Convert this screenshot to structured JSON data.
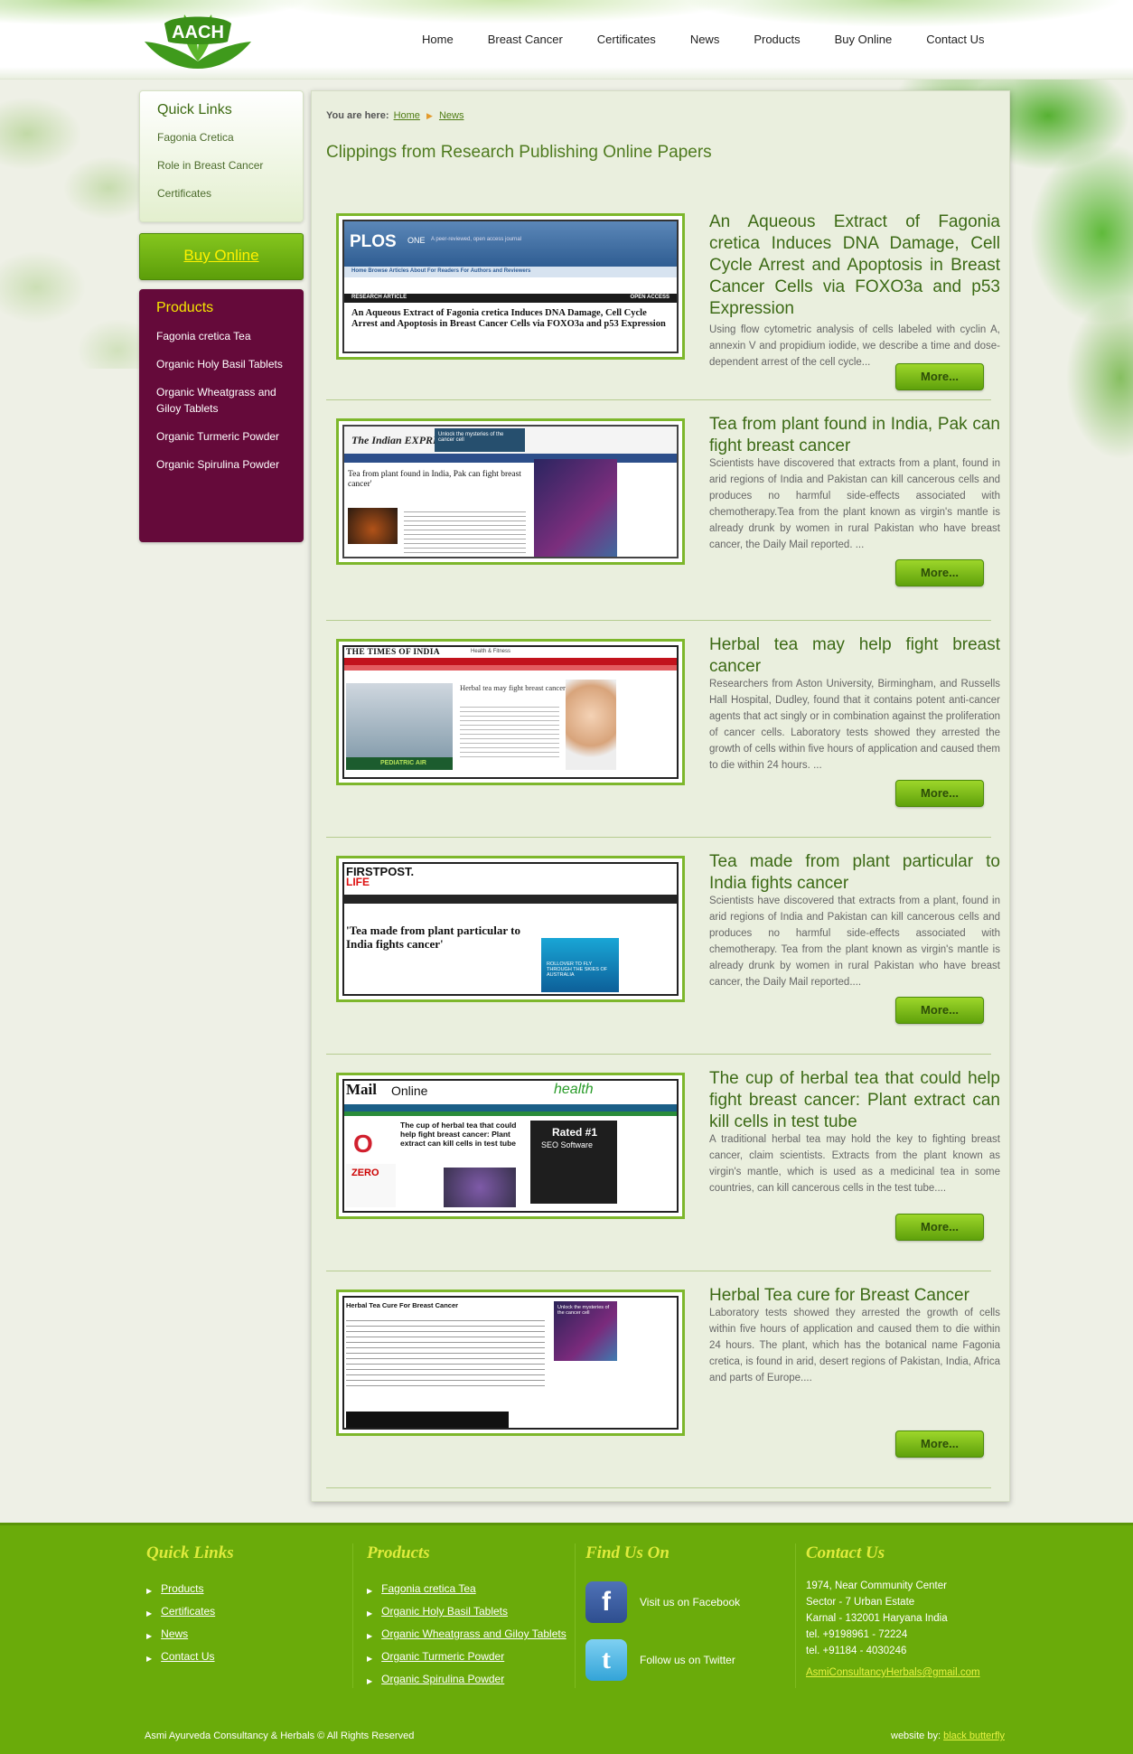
{
  "nav": [
    "Home",
    "Breast Cancer",
    "Certificates",
    "News",
    "Products",
    "Buy Online",
    "Contact Us"
  ],
  "logo_text": "AACH",
  "sidebar": {
    "quick_links_title": "Quick Links",
    "quick_links": [
      "Fagonia Cretica",
      "Role in Breast Cancer",
      "Certificates"
    ],
    "buy_online": "Buy Online",
    "products_title": "Products",
    "products": [
      "Fagonia cretica Tea",
      "Organic Holy Basil Tablets",
      "Organic Wheatgrass and Giloy Tablets",
      "Organic Turmeric Powder",
      "Organic Spirulina Powder"
    ]
  },
  "breadcrumb": {
    "label": "You are here:",
    "home": "Home",
    "current": "News"
  },
  "page_title": "Clippings from Research Publishing Online Papers",
  "more_label": "More...",
  "articles": [
    {
      "title": "An Aqueous Extract of Fagonia cretica Induces DNA Damage, Cell Cycle Arrest and Apoptosis in Breast Cancer Cells via FOXO3a and p53 Expression",
      "text": "Using flow cytometric analysis of cells labeled with cyclin A, annexin V and propidium iodide, we describe a time and dose-dependent arrest of the cell cycle..."
    },
    {
      "title": "Tea from plant found in India, Pak can fight breast cancer",
      "text": "Scientists have discovered that extracts from a plant, found in arid regions of India and Pakistan can kill cancerous cells and produces no harmful side-effects associated with chemotherapy.Tea from the plant known as virgin's mantle is already drunk by women in rural Pakistan who have breast cancer, the Daily Mail reported. ..."
    },
    {
      "title": "Herbal tea may help fight breast cancer",
      "text": "Researchers from Aston University, Birmingham, and Russells Hall Hospital, Dudley, found that it contains potent anti-cancer agents that act singly or in combination against the proliferation of cancer cells. Laboratory tests showed they arrested the growth of cells within five hours of application and caused them to die within 24 hours. ..."
    },
    {
      "title": "Tea made from plant particular to India fights cancer",
      "text": "Scientists have discovered that extracts from a plant, found in arid regions of India and Pakistan can kill cancerous cells and produces no harmful side-effects associated with chemotherapy. Tea from the plant known as virgin's mantle is already drunk by women in rural Pakistan who have breast cancer, the Daily Mail reported...."
    },
    {
      "title": "The cup of herbal tea that could help fight breast cancer: Plant extract can kill cells in test tube",
      "text": "A traditional herbal tea may hold the key to fighting breast cancer, claim scientists. Extracts from the plant known as virgin's mantle, which is used as a medicinal tea in some countries, can kill cancerous cells in the test tube...."
    },
    {
      "title": "Herbal Tea cure for Breast Cancer",
      "text": "Laboratory tests showed they arrested the growth of cells within five hours of application and caused them to die within 24 hours. The plant, which has the botanical name Fagonia cretica, is found in arid, desert regions of Pakistan, India, Africa and parts of Europe...."
    }
  ],
  "clippings": {
    "c1": {
      "brand": "PLOS",
      "one": "ONE",
      "tagline": "A peer-reviewed, open access journal",
      "nav": "Home   Browse Articles   About   For Readers   For Authors and Reviewers",
      "tag": "RESEARCH ARTICLE",
      "open": "OPEN ACCESS",
      "headline": "An Aqueous Extract of Fagonia cretica Induces DNA Damage, Cell Cycle Arrest and Apoptosis in Breast Cancer Cells via FOXO3a and p53 Expression"
    },
    "c2": {
      "paper": "The Indian EXPRESS",
      "ad": "Unlock the mysteries of the cancer cell",
      "headline": "Tea from plant found in India, Pak can fight breast cancer'"
    },
    "c3": {
      "paper": "THE TIMES OF INDIA",
      "section": "Health & Fitness",
      "headline": "Herbal tea may fight breast cancer",
      "ad": "PEDIATRIC AIR"
    },
    "c4": {
      "paper": "FIRSTPOST.",
      "sub": "LIFE",
      "headline": "'Tea made from plant particular to India fights cancer'",
      "ad": "ROLLOVER TO FLY THROUGH THE SKIES OF AUSTRALIA"
    },
    "c5": {
      "paper": "Mail",
      "online": "Online",
      "health": "health",
      "headline": "The cup of herbal tea that could help fight breast cancer: Plant extract can kill cells in test tube",
      "ad1": "ZERO",
      "ad2": "Rated #1",
      "ad3": "SEO Software"
    },
    "c6": {
      "headline": "Herbal Tea Cure For Breast Cancer",
      "ad": "Unlock the mysteries of the cancer cell"
    }
  },
  "footer": {
    "quick_title": "Quick Links",
    "quick": [
      "Products",
      "Certificates",
      "News",
      "Contact Us"
    ],
    "products_title": "Products",
    "products": [
      "Fagonia cretica Tea",
      "Organic Holy Basil Tablets",
      "Organic Wheatgrass and Giloy Tablets",
      "Organic Turmeric Powder",
      "Organic Spirulina Powder"
    ],
    "find_title": "Find Us On",
    "facebook": "Visit us on Facebook",
    "twitter": "Follow us on Twitter",
    "contact_title": "Contact Us",
    "address": [
      "1974, Near Community Center",
      "Sector - 7 Urban Estate",
      "Karnal - 132001 Haryana India",
      "tel. +9198961 - 72224",
      "tel. +91184 - 4030246"
    ],
    "email": "AsmiConsultancyHerbals@gmail.com",
    "copyright": "Asmi Ayurveda Consultancy & Herbals © All Rights Reserved",
    "credit_label": "website by:",
    "credit_link": "black butterfly"
  },
  "colors": {
    "brand_green": "#6aab0a",
    "product_box": "#650a3a",
    "title_green": "#3c6a15",
    "accent_yellow": "#f5e600"
  }
}
